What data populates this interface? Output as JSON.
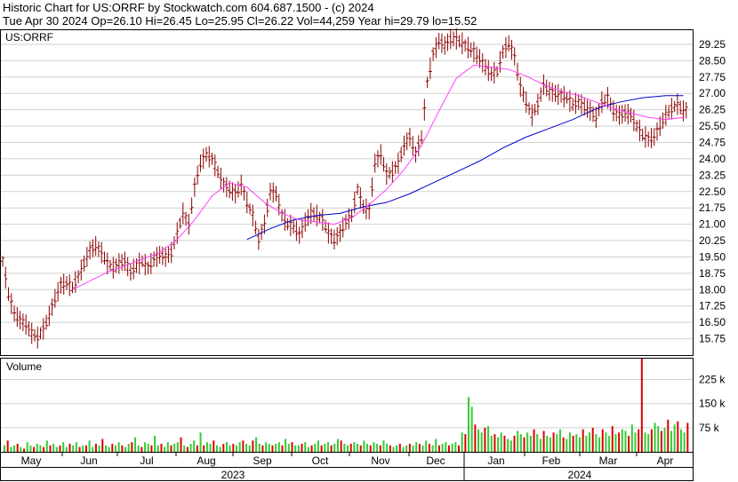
{
  "header": {
    "line1": "Historic Chart for US:ORRF by Stockwatch.com 604.687.1500 - (c) 2024",
    "line2": "Tue Apr 30 2024   Op=26.10  Hi=26.45  Lo=25.95  Cl=26.22  Vol=44,259   Year hi=29.79  lo=15.52"
  },
  "colors": {
    "bars": "#8b0000",
    "ma_short": "#ff40ff",
    "ma_long": "#0000cc",
    "vol_up": "#33cc33",
    "vol_down": "#dd0000",
    "grid": "#d0d0d0"
  },
  "chart_data": [
    {
      "type": "ohlc",
      "title": "US:ORRF",
      "ylim": [
        15.0,
        29.9
      ],
      "yticks": [
        "29.25",
        "28.50",
        "27.75",
        "27.00",
        "26.25",
        "25.50",
        "24.75",
        "24.00",
        "23.25",
        "22.50",
        "21.75",
        "21.00",
        "20.25",
        "19.50",
        "18.75",
        "18.00",
        "17.25",
        "16.50",
        "15.75"
      ],
      "grid": true,
      "series": [
        {
          "kind": "price_bars",
          "points": [
            [
              0,
              19.3
            ],
            [
              2,
              17.8
            ],
            [
              4,
              16.9
            ],
            [
              6,
              16.6
            ],
            [
              8,
              16.4
            ],
            [
              10,
              16.0
            ],
            [
              12,
              15.8
            ],
            [
              14,
              16.2
            ],
            [
              16,
              16.8
            ],
            [
              18,
              17.6
            ],
            [
              20,
              18.2
            ],
            [
              22,
              18.3
            ],
            [
              24,
              18.1
            ],
            [
              26,
              18.6
            ],
            [
              28,
              19.2
            ],
            [
              30,
              19.8
            ],
            [
              32,
              20.0
            ],
            [
              34,
              19.7
            ],
            [
              36,
              19.2
            ],
            [
              38,
              19.0
            ],
            [
              40,
              19.2
            ],
            [
              42,
              19.3
            ],
            [
              44,
              18.8
            ],
            [
              46,
              19.1
            ],
            [
              48,
              19.3
            ],
            [
              50,
              19.0
            ],
            [
              52,
              19.4
            ],
            [
              54,
              19.6
            ],
            [
              56,
              19.5
            ],
            [
              58,
              19.7
            ],
            [
              60,
              20.6
            ],
            [
              62,
              21.5
            ],
            [
              64,
              21.0
            ],
            [
              66,
              22.7
            ],
            [
              68,
              23.8
            ],
            [
              70,
              24.2
            ],
            [
              72,
              24.0
            ],
            [
              74,
              23.4
            ],
            [
              76,
              22.8
            ],
            [
              78,
              22.6
            ],
            [
              80,
              22.4
            ],
            [
              82,
              22.8
            ],
            [
              84,
              22.0
            ],
            [
              86,
              21.4
            ],
            [
              88,
              20.3
            ],
            [
              90,
              21.0
            ],
            [
              92,
              22.5
            ],
            [
              94,
              22.4
            ],
            [
              96,
              21.4
            ],
            [
              98,
              21.0
            ],
            [
              100,
              20.9
            ],
            [
              102,
              20.5
            ],
            [
              104,
              21.1
            ],
            [
              106,
              21.5
            ],
            [
              108,
              21.4
            ],
            [
              110,
              21.2
            ],
            [
              112,
              20.6
            ],
            [
              114,
              20.3
            ],
            [
              116,
              20.6
            ],
            [
              118,
              21.1
            ],
            [
              120,
              21.4
            ],
            [
              122,
              22.6
            ],
            [
              124,
              21.8
            ],
            [
              126,
              21.6
            ],
            [
              128,
              23.8
            ],
            [
              130,
              24.2
            ],
            [
              132,
              23.3
            ],
            [
              134,
              23.4
            ],
            [
              136,
              23.8
            ],
            [
              138,
              24.6
            ],
            [
              140,
              25.0
            ],
            [
              142,
              24.2
            ],
            [
              144,
              25.0
            ],
            [
              146,
              27.5
            ],
            [
              148,
              28.8
            ],
            [
              150,
              29.4
            ],
            [
              152,
              29.2
            ],
            [
              154,
              29.5
            ],
            [
              156,
              29.5
            ],
            [
              158,
              29.3
            ],
            [
              160,
              29.1
            ],
            [
              162,
              28.9
            ],
            [
              164,
              28.6
            ],
            [
              166,
              28.2
            ],
            [
              168,
              27.9
            ],
            [
              170,
              28.0
            ],
            [
              172,
              28.9
            ],
            [
              174,
              29.3
            ],
            [
              176,
              28.7
            ],
            [
              178,
              27.3
            ],
            [
              180,
              26.6
            ],
            [
              182,
              26.0
            ],
            [
              184,
              26.5
            ],
            [
              186,
              27.4
            ],
            [
              188,
              27.1
            ],
            [
              190,
              27.0
            ],
            [
              192,
              26.9
            ],
            [
              194,
              26.8
            ],
            [
              196,
              26.5
            ],
            [
              198,
              26.6
            ],
            [
              200,
              26.4
            ],
            [
              202,
              26.2
            ],
            [
              204,
              25.9
            ],
            [
              206,
              26.6
            ],
            [
              208,
              26.8
            ],
            [
              210,
              26.2
            ],
            [
              212,
              26.0
            ],
            [
              214,
              26.1
            ],
            [
              216,
              26.0
            ],
            [
              218,
              25.5
            ],
            [
              220,
              25.1
            ],
            [
              222,
              24.9
            ],
            [
              224,
              25.0
            ],
            [
              226,
              25.5
            ],
            [
              228,
              26.0
            ],
            [
              230,
              26.3
            ],
            [
              232,
              26.5
            ],
            [
              234,
              26.2
            ]
          ]
        },
        {
          "kind": "moving_average_short",
          "points": [
            [
              24,
              18.0
            ],
            [
              30,
              18.4
            ],
            [
              36,
              18.8
            ],
            [
              42,
              19.1
            ],
            [
              48,
              19.4
            ],
            [
              54,
              19.7
            ],
            [
              60,
              20.3
            ],
            [
              66,
              21.2
            ],
            [
              72,
              22.3
            ],
            [
              78,
              22.9
            ],
            [
              84,
              22.7
            ],
            [
              90,
              22.0
            ],
            [
              96,
              21.5
            ],
            [
              102,
              21.2
            ],
            [
              108,
              21.1
            ],
            [
              114,
              21.0
            ],
            [
              120,
              21.3
            ],
            [
              126,
              21.9
            ],
            [
              132,
              22.6
            ],
            [
              138,
              23.5
            ],
            [
              144,
              24.6
            ],
            [
              150,
              26.2
            ],
            [
              156,
              27.7
            ],
            [
              162,
              28.3
            ],
            [
              168,
              28.2
            ],
            [
              174,
              28.1
            ],
            [
              180,
              27.8
            ],
            [
              186,
              27.4
            ],
            [
              192,
              27.1
            ],
            [
              198,
              26.9
            ],
            [
              204,
              26.6
            ],
            [
              210,
              26.3
            ],
            [
              216,
              26.1
            ],
            [
              222,
              25.9
            ],
            [
              228,
              25.8
            ],
            [
              234,
              25.9
            ]
          ]
        },
        {
          "kind": "moving_average_long",
          "points": [
            [
              84,
              20.3
            ],
            [
              92,
              20.8
            ],
            [
              100,
              21.2
            ],
            [
              108,
              21.4
            ],
            [
              116,
              21.5
            ],
            [
              124,
              21.8
            ],
            [
              132,
              22.0
            ],
            [
              140,
              22.4
            ],
            [
              148,
              22.9
            ],
            [
              156,
              23.4
            ],
            [
              164,
              23.9
            ],
            [
              172,
              24.5
            ],
            [
              180,
              25.0
            ],
            [
              188,
              25.4
            ],
            [
              196,
              25.8
            ],
            [
              204,
              26.3
            ],
            [
              212,
              26.6
            ],
            [
              220,
              26.8
            ],
            [
              228,
              26.9
            ],
            [
              234,
              26.9
            ]
          ]
        }
      ]
    },
    {
      "type": "bar",
      "title": "Volume",
      "yticks": [
        "225 k",
        "150 k",
        "75 k"
      ],
      "ylim": [
        0,
        290
      ],
      "values": [
        20,
        35,
        15,
        20,
        25,
        15,
        10,
        30,
        20,
        15,
        25,
        20,
        15,
        35,
        20,
        25,
        15,
        20,
        30,
        15,
        25,
        20,
        30,
        15,
        20,
        20,
        35,
        15,
        25,
        20,
        40,
        20,
        15,
        25,
        20,
        30,
        20,
        15,
        25,
        30,
        45,
        20,
        15,
        30,
        25,
        20,
        50,
        20,
        25,
        15,
        30,
        20,
        25,
        30,
        45,
        20,
        15,
        25,
        35,
        20,
        60,
        20,
        30,
        25,
        35,
        20,
        15,
        25,
        30,
        20,
        25,
        20,
        30,
        35,
        25,
        20,
        35,
        45,
        25,
        20,
        30,
        25,
        20,
        25,
        30,
        20,
        40,
        25,
        30,
        20,
        20,
        25,
        30,
        15,
        20,
        25,
        35,
        20,
        25,
        30,
        20,
        25,
        40,
        35,
        25,
        20,
        25,
        30,
        25,
        20,
        35,
        25,
        20,
        30,
        25,
        20,
        35,
        25,
        20,
        15,
        20,
        25,
        15,
        20,
        25,
        20,
        30,
        25,
        20,
        35,
        25,
        20,
        40,
        20,
        25,
        30,
        20,
        25,
        30,
        20,
        60,
        55,
        170,
        140,
        85,
        70,
        60,
        75,
        80,
        50,
        55,
        45,
        60,
        50,
        40,
        35,
        50,
        65,
        55,
        45,
        60,
        50,
        70,
        55,
        40,
        65,
        50,
        45,
        60,
        55,
        70,
        45,
        40,
        60,
        50,
        55,
        45,
        70,
        50,
        60,
        75,
        55,
        45,
        70,
        60,
        50,
        80,
        55,
        60,
        70,
        65,
        50,
        85,
        60,
        70,
        290,
        60,
        55,
        70,
        90,
        80,
        65,
        75,
        100,
        65,
        85,
        95,
        70,
        60,
        90
      ],
      "up": [
        1,
        0,
        1,
        1,
        0,
        1,
        0,
        1,
        1,
        0,
        1,
        1,
        0,
        1,
        0,
        1,
        1,
        0,
        1,
        1,
        0,
        1,
        1,
        0,
        1,
        0,
        1,
        1,
        0,
        1,
        0,
        1,
        1,
        0,
        1,
        1,
        0,
        1,
        1,
        0,
        1,
        1,
        0,
        1,
        1,
        0,
        1,
        1,
        0,
        1,
        1,
        0,
        1,
        1,
        0,
        1,
        0,
        1,
        1,
        0,
        1,
        0,
        1,
        1,
        0,
        1,
        1,
        0,
        1,
        1,
        0,
        1,
        1,
        0,
        1,
        1,
        0,
        1,
        1,
        0,
        1,
        1,
        0,
        1,
        1,
        0,
        1,
        1,
        0,
        1,
        1,
        0,
        1,
        1,
        0,
        1,
        1,
        0,
        1,
        1,
        0,
        1,
        1,
        0,
        1,
        1,
        0,
        1,
        1,
        0,
        1,
        1,
        0,
        1,
        1,
        0,
        1,
        1,
        0,
        1,
        1,
        0,
        1,
        1,
        0,
        1,
        1,
        0,
        1,
        1,
        0,
        1,
        1,
        0,
        1,
        1,
        0,
        1,
        1,
        0,
        1,
        0,
        1,
        1,
        0,
        1,
        1,
        0,
        1,
        1,
        0,
        1,
        1,
        0,
        1,
        1,
        0,
        1,
        1,
        0,
        1,
        1,
        0,
        1,
        1,
        0,
        1,
        1,
        0,
        1,
        1,
        0,
        1,
        1,
        0,
        1,
        1,
        0,
        1,
        1,
        0,
        1,
        1,
        0,
        1,
        1,
        0,
        1,
        0,
        1,
        1,
        0,
        1,
        1,
        0,
        0,
        1,
        1,
        0,
        1,
        1,
        0,
        1,
        0,
        1,
        1,
        0,
        1,
        1,
        0
      ]
    }
  ],
  "x_axis": {
    "months": [
      "May",
      "Jun",
      "Jul",
      "Aug",
      "Sep",
      "Oct",
      "Nov",
      "Dec",
      "Jan",
      "Feb",
      "Mar",
      "Apr"
    ],
    "years": [
      "2023",
      "2024"
    ]
  }
}
